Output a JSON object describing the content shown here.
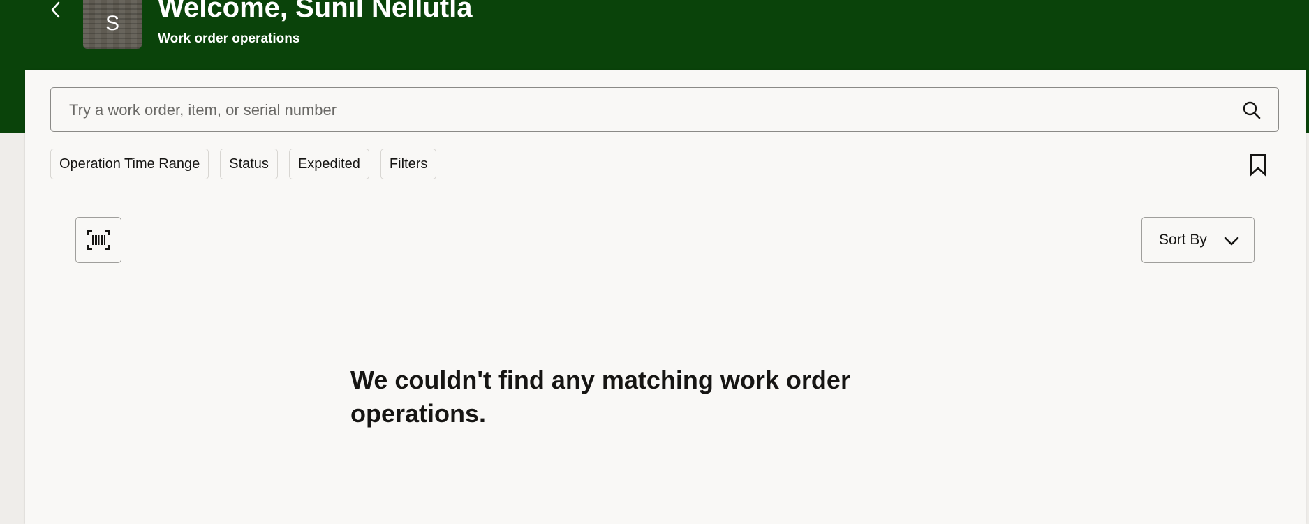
{
  "header": {
    "back_icon": "chevron-left-icon",
    "avatar_initial": "S",
    "welcome": "Welcome, Sunil Nellutla",
    "subtitle": "Work order operations",
    "background_color": "#0a430a"
  },
  "search": {
    "placeholder": "Try a work order, item, or serial number",
    "value": "",
    "icon": "search-icon"
  },
  "filters": {
    "chips": [
      "Operation Time Range",
      "Status",
      "Expedited",
      "Filters"
    ],
    "bookmark_icon": "bookmark-icon"
  },
  "toolbar": {
    "barcode_icon": "barcode-scan-icon",
    "sort_label": "Sort By",
    "sort_icon": "chevron-down-icon"
  },
  "main": {
    "empty_message": "We couldn't find any matching work order operations."
  }
}
